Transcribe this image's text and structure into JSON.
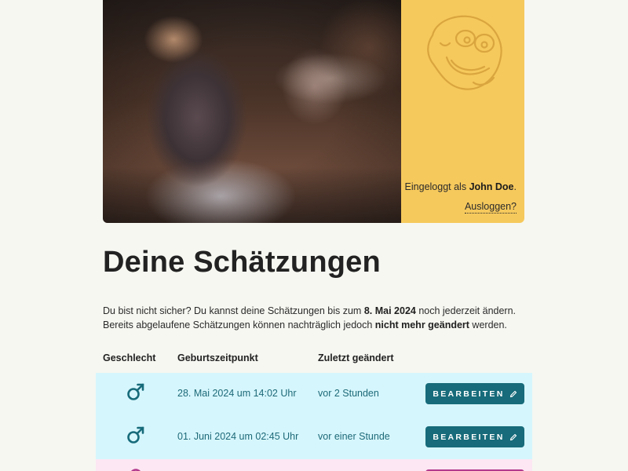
{
  "header": {
    "logged_in_prefix": "Eingeloggt als ",
    "user_name": "John Doe",
    "logged_in_suffix": ".",
    "logout_label": "Ausloggen?"
  },
  "page": {
    "title": "Deine Schätzungen",
    "intro": {
      "line1_prefix": "Du bist nicht sicher? Du kannst deine Schätzungen bis zum ",
      "deadline": "8. Mai 2024",
      "line1_suffix": " noch jederzeit ändern.",
      "line2_prefix": "Bereits abgelaufene Schätzungen können nachträglich jedoch ",
      "line2_bold": "nicht mehr geändert",
      "line2_suffix": " werden."
    }
  },
  "table": {
    "columns": [
      "Geschlecht",
      "Geburtszeitpunkt",
      "Zuletzt geändert"
    ],
    "rows": [
      {
        "gender": "male-icon",
        "birth": "28. Mai 2024 um 14:02 Uhr",
        "changed": "vor 2 Stunden",
        "action": "BEARBEITEN",
        "color": "#d6f6fd"
      },
      {
        "gender": "male-icon",
        "birth": "01. Juni 2024 um 02:45 Uhr",
        "changed": "vor einer Stunde",
        "action": "BEARBEITEN",
        "color": "#d6f6fd"
      },
      {
        "gender": "female-icon",
        "birth": "",
        "changed": "",
        "action": "",
        "color": "#fde7f3"
      }
    ]
  },
  "colors": {
    "background": "#f6f7f1",
    "panel_yellow": "#f6c95c",
    "accent_teal": "#176b7a",
    "accent_magenta": "#b23a8d"
  }
}
